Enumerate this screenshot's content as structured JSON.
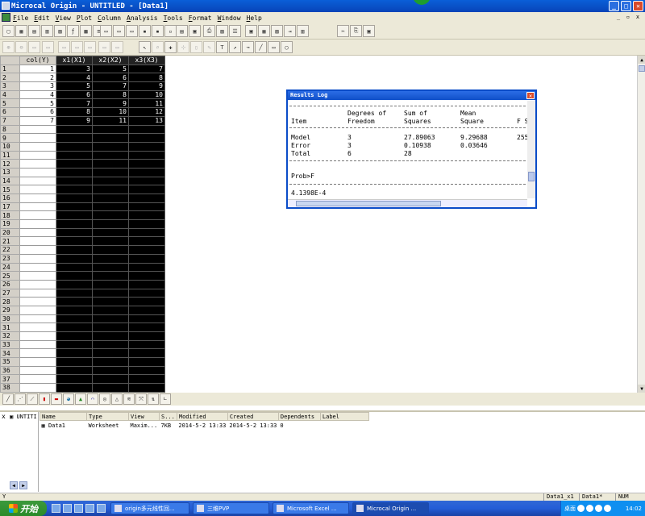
{
  "window": {
    "title": "Microcal Origin - UNTITLED - [Data1]",
    "minimize": "_",
    "restore": "□",
    "close": "✕"
  },
  "menu": [
    "File",
    "Edit",
    "View",
    "Plot",
    "Column",
    "Analysis",
    "Tools",
    "Format",
    "Window",
    "Help"
  ],
  "worksheet": {
    "columns": [
      "col(Y)",
      "x1(X1)",
      "x2(X2)",
      "x3(X3)"
    ],
    "rows": [
      [
        "1",
        "1",
        "3",
        "5",
        "7"
      ],
      [
        "2",
        "2",
        "4",
        "6",
        "8"
      ],
      [
        "3",
        "3",
        "5",
        "7",
        "9"
      ],
      [
        "4",
        "4",
        "6",
        "8",
        "10"
      ],
      [
        "5",
        "5",
        "7",
        "9",
        "11"
      ],
      [
        "6",
        "6",
        "8",
        "10",
        "12"
      ],
      [
        "7",
        "7",
        "9",
        "11",
        "13"
      ],
      [
        "8",
        "",
        "",
        "",
        ""
      ],
      [
        "9",
        "",
        "",
        "",
        ""
      ],
      [
        "10",
        "",
        "",
        "",
        ""
      ],
      [
        "11",
        "",
        "",
        "",
        ""
      ],
      [
        "12",
        "",
        "",
        "",
        ""
      ],
      [
        "13",
        "",
        "",
        "",
        ""
      ],
      [
        "14",
        "",
        "",
        "",
        ""
      ],
      [
        "15",
        "",
        "",
        "",
        ""
      ],
      [
        "16",
        "",
        "",
        "",
        ""
      ],
      [
        "17",
        "",
        "",
        "",
        ""
      ],
      [
        "18",
        "",
        "",
        "",
        ""
      ],
      [
        "19",
        "",
        "",
        "",
        ""
      ],
      [
        "20",
        "",
        "",
        "",
        ""
      ],
      [
        "21",
        "",
        "",
        "",
        ""
      ],
      [
        "22",
        "",
        "",
        "",
        ""
      ],
      [
        "23",
        "",
        "",
        "",
        ""
      ],
      [
        "24",
        "",
        "",
        "",
        ""
      ],
      [
        "25",
        "",
        "",
        "",
        ""
      ],
      [
        "26",
        "",
        "",
        "",
        ""
      ],
      [
        "27",
        "",
        "",
        "",
        ""
      ],
      [
        "28",
        "",
        "",
        "",
        ""
      ],
      [
        "29",
        "",
        "",
        "",
        ""
      ],
      [
        "30",
        "",
        "",
        "",
        ""
      ],
      [
        "31",
        "",
        "",
        "",
        ""
      ],
      [
        "32",
        "",
        "",
        "",
        ""
      ],
      [
        "33",
        "",
        "",
        "",
        ""
      ],
      [
        "34",
        "",
        "",
        "",
        ""
      ],
      [
        "35",
        "",
        "",
        "",
        ""
      ],
      [
        "36",
        "",
        "",
        "",
        ""
      ],
      [
        "37",
        "",
        "",
        "",
        ""
      ],
      [
        "38",
        "",
        "",
        "",
        ""
      ]
    ]
  },
  "results_log": {
    "title": "Results Log",
    "col_item": "Item",
    "col_df_1": "Degrees of",
    "col_df_2": "Freedom",
    "col_ss_1": "Sum of",
    "col_ss_2": "Squares",
    "col_ms_1": "Mean",
    "col_ms_2": "Square",
    "col_f": "F S",
    "model": {
      "label": "Model",
      "df": "3",
      "ss": "27.89063",
      "ms": "9.29688",
      "f": "255"
    },
    "error": {
      "label": "Error",
      "df": "3",
      "ss": "0.10938",
      "ms": "0.03646"
    },
    "total": {
      "label": "Total",
      "df": "6",
      "ss": "28"
    },
    "prob_label": "Prob>F",
    "prob_value": "4.1398E-4"
  },
  "explorer": {
    "tree_node": "UNTITI",
    "headers": [
      "Name",
      "Type",
      "View",
      "S...",
      "Modified",
      "Created",
      "Dependents",
      "Label"
    ],
    "row": {
      "name": "Data1",
      "type": "Worksheet",
      "view": "Maxim...",
      "size": "7KB",
      "modified": "2014-5-2 13:33",
      "created": "2014-5-2 13:33",
      "dependents": "0",
      "label": ""
    }
  },
  "status": {
    "left": "Y",
    "cell1": "Data1_x1",
    "cell2": "Data1*",
    "cell3": "NUM"
  },
  "taskbar": {
    "start": "开始",
    "tasks": [
      "origin多元线性回...",
      "三维PVP",
      "Microsoft Excel ...",
      "Microcal Origin ..."
    ],
    "tray_text": "桌面",
    "clock": "14:02"
  }
}
